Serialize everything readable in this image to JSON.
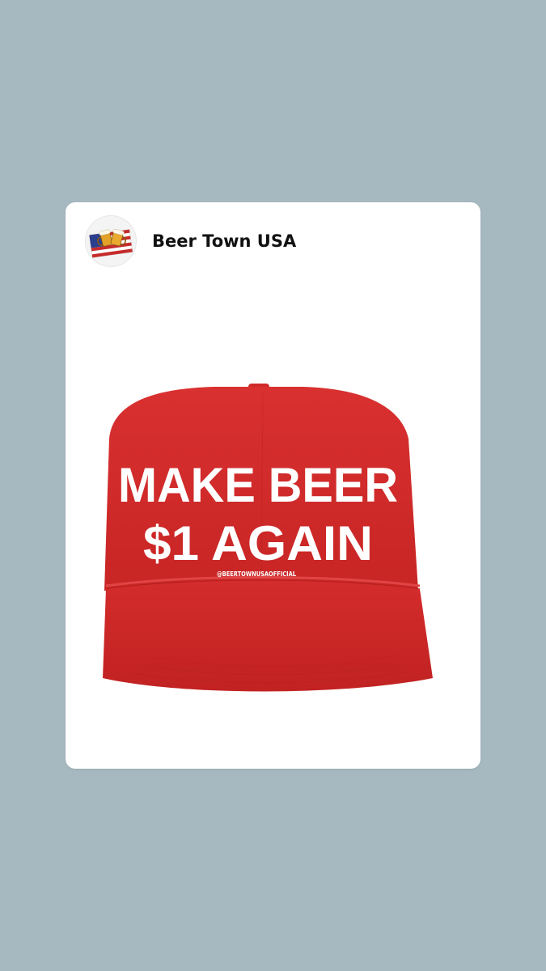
{
  "post": {
    "account_name": "Beer Town USA",
    "avatar_icon": "flag-with-beer-mugs-icon",
    "image": {
      "subject": "red-cap-icon",
      "line1": "MAKE BEER",
      "line2": "$1 AGAIN",
      "handle": "@BEERTOWNUSAOFFICIAL"
    }
  },
  "colors": {
    "background": "#a6b8c0",
    "card": "#ffffff",
    "cap_red": "#d52a2a",
    "text": "#111111"
  }
}
